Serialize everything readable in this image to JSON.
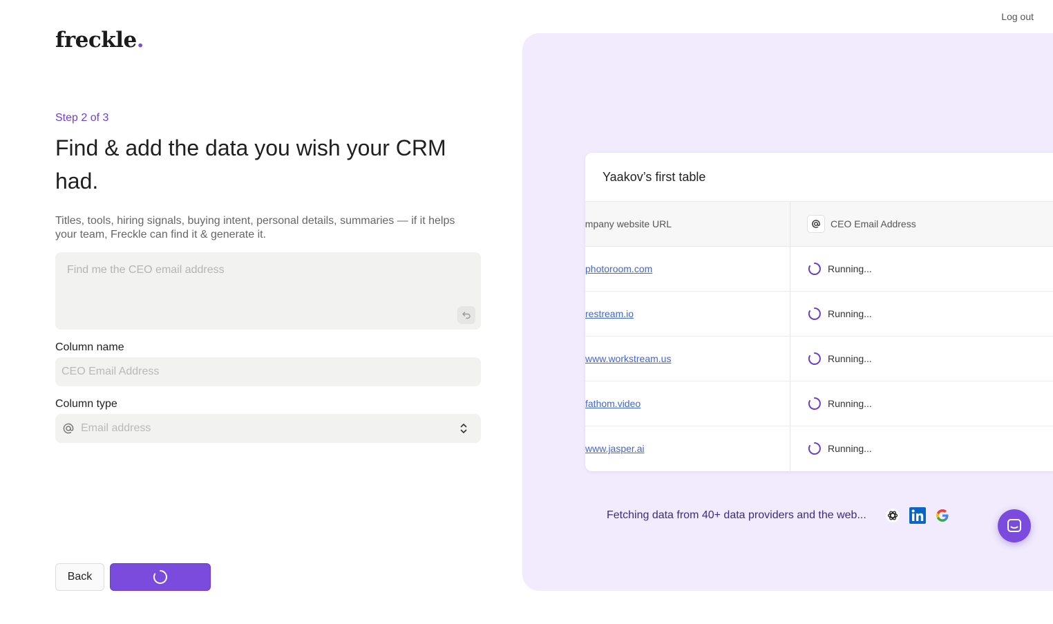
{
  "brand": {
    "name": "freckle",
    "dot": ".",
    "accent": "#7c4dde"
  },
  "header": {
    "logout_label": "Log out"
  },
  "form": {
    "step_label": "Step 2 of 3",
    "heading": "Find & add the data you wish your CRM had.",
    "description": "Titles, tools, hiring signals, buying intent, personal details, summaries — if it helps your team, Freckle can find it & generate it.",
    "prompt": {
      "value": "",
      "placeholder": "Find me the CEO email address"
    },
    "column_name": {
      "label": "Column name",
      "value": "",
      "placeholder": "CEO Email Address"
    },
    "column_type": {
      "label": "Column type",
      "value": "Email address",
      "icon": "at-icon"
    },
    "back_label": "Back",
    "next_state": "loading"
  },
  "preview": {
    "table_title": "Yaakov’s first table",
    "columns": [
      "ompany website URL",
      "CEO Email Address"
    ],
    "rows": [
      {
        "url": "photoroom.com",
        "status": "Running..."
      },
      {
        "url": "restream.io",
        "status": "Running..."
      },
      {
        "url": "www.workstream.us",
        "status": "Running..."
      },
      {
        "url": "fathom.video",
        "status": "Running..."
      },
      {
        "url": "www.jasper.ai",
        "status": "Running..."
      }
    ],
    "fetching_text": "Fetching data from 40+ data providers and the web...",
    "providers": [
      "openai-icon",
      "linkedin-icon",
      "google-icon"
    ]
  },
  "colors": {
    "accent": "#7a4bdc",
    "panel_bg": "#f1ebfd",
    "link": "#4065d6"
  }
}
